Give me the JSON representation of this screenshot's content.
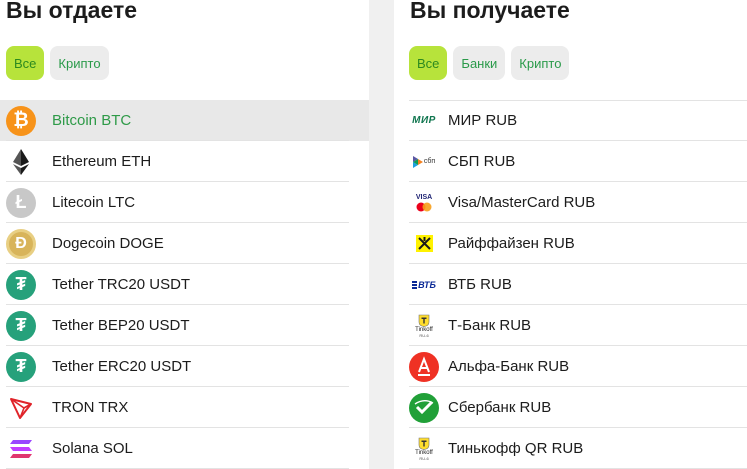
{
  "give": {
    "title": "Вы отдаете",
    "filters": [
      "Все",
      "Крипто"
    ],
    "active_filter": "Все",
    "items": [
      {
        "label": "Bitcoin BTC",
        "icon": "bitcoin-icon",
        "selected": true
      },
      {
        "label": "Ethereum ETH",
        "icon": "ethereum-icon"
      },
      {
        "label": "Litecoin LTC",
        "icon": "litecoin-icon"
      },
      {
        "label": "Dogecoin DOGE",
        "icon": "dogecoin-icon"
      },
      {
        "label": "Tether TRC20 USDT",
        "icon": "tether-icon"
      },
      {
        "label": "Tether BEP20 USDT",
        "icon": "tether-icon"
      },
      {
        "label": "Tether ERC20 USDT",
        "icon": "tether-icon"
      },
      {
        "label": "TRON TRX",
        "icon": "tron-icon"
      },
      {
        "label": "Solana SOL",
        "icon": "solana-icon"
      }
    ]
  },
  "get": {
    "title": "Вы получаете",
    "filters": [
      "Все",
      "Банки",
      "Крипто"
    ],
    "active_filter": "Все",
    "items": [
      {
        "label": "МИР RUB",
        "icon": "mir-icon"
      },
      {
        "label": "СБП RUB",
        "icon": "sbp-icon"
      },
      {
        "label": "Visa/MasterCard RUB",
        "icon": "visa-mastercard-icon"
      },
      {
        "label": "Райффайзен RUB",
        "icon": "raiffeisen-icon"
      },
      {
        "label": "ВТБ RUB",
        "icon": "vtb-icon"
      },
      {
        "label": "Т-Банк RUB",
        "icon": "tinkoff-icon"
      },
      {
        "label": "Альфа-Банк RUB",
        "icon": "alfa-bank-icon"
      },
      {
        "label": "Сбербанк RUB",
        "icon": "sberbank-icon"
      },
      {
        "label": "Тинькофф QR RUB",
        "icon": "tinkoff-icon"
      }
    ]
  },
  "icon_text": {
    "bitcoin": "₿",
    "litecoin": "Ł",
    "dogecoin": "Ð",
    "tether": "₮",
    "mir": "МИР",
    "sbp": "сбп",
    "visa": "VISA",
    "vtb": "ВТБ",
    "tinkoff_line1": "Tinkoff",
    "tinkoff_line2": "RU-6"
  },
  "colors": {
    "accent_green": "#2e9a48",
    "active_chip": "#b7e33b",
    "bitcoin": "#f7931a",
    "tether": "#26a17b",
    "tron": "#e0242a",
    "alfa": "#ef3124",
    "sber": "#21a038",
    "raiffeisen": "#fff200",
    "vtb": "#0a2896",
    "mir": "#0f754e"
  }
}
